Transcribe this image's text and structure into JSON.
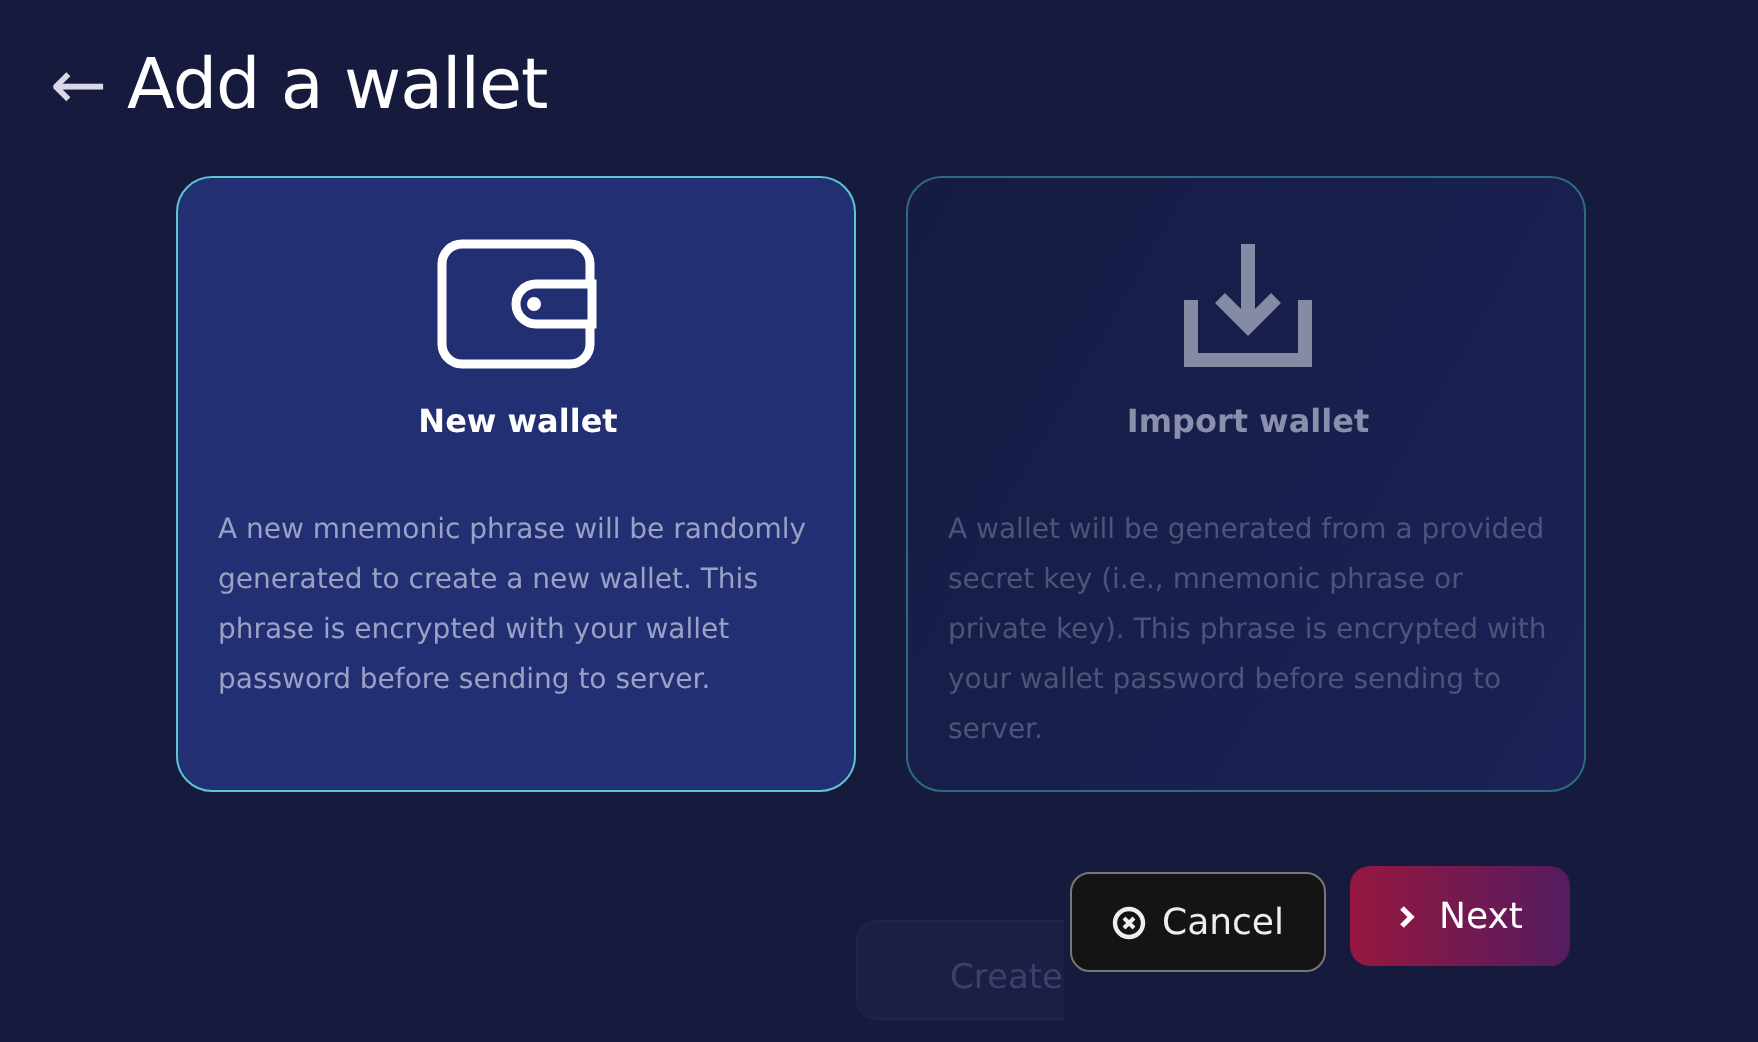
{
  "header": {
    "back_icon": "←",
    "title": "Add a wallet"
  },
  "options": [
    {
      "kind": "wallet",
      "title": "New wallet",
      "description": "A new mnemonic phrase will be randomly generated to create a new wallet. This phrase is encrypted with your wallet password before sending to server.",
      "selected": true
    },
    {
      "kind": "import",
      "title": "Import wallet",
      "description": "A wallet will be generated from a provided secret key (i.e., mnemonic phrase or private key). This phrase is encrypted with your wallet password before sending to server.",
      "selected": false
    }
  ],
  "background_button": {
    "label": "Create"
  },
  "buttons": [
    {
      "kind": "cancel",
      "label": "Cancel"
    },
    {
      "kind": "next",
      "label": "Next"
    }
  ]
}
